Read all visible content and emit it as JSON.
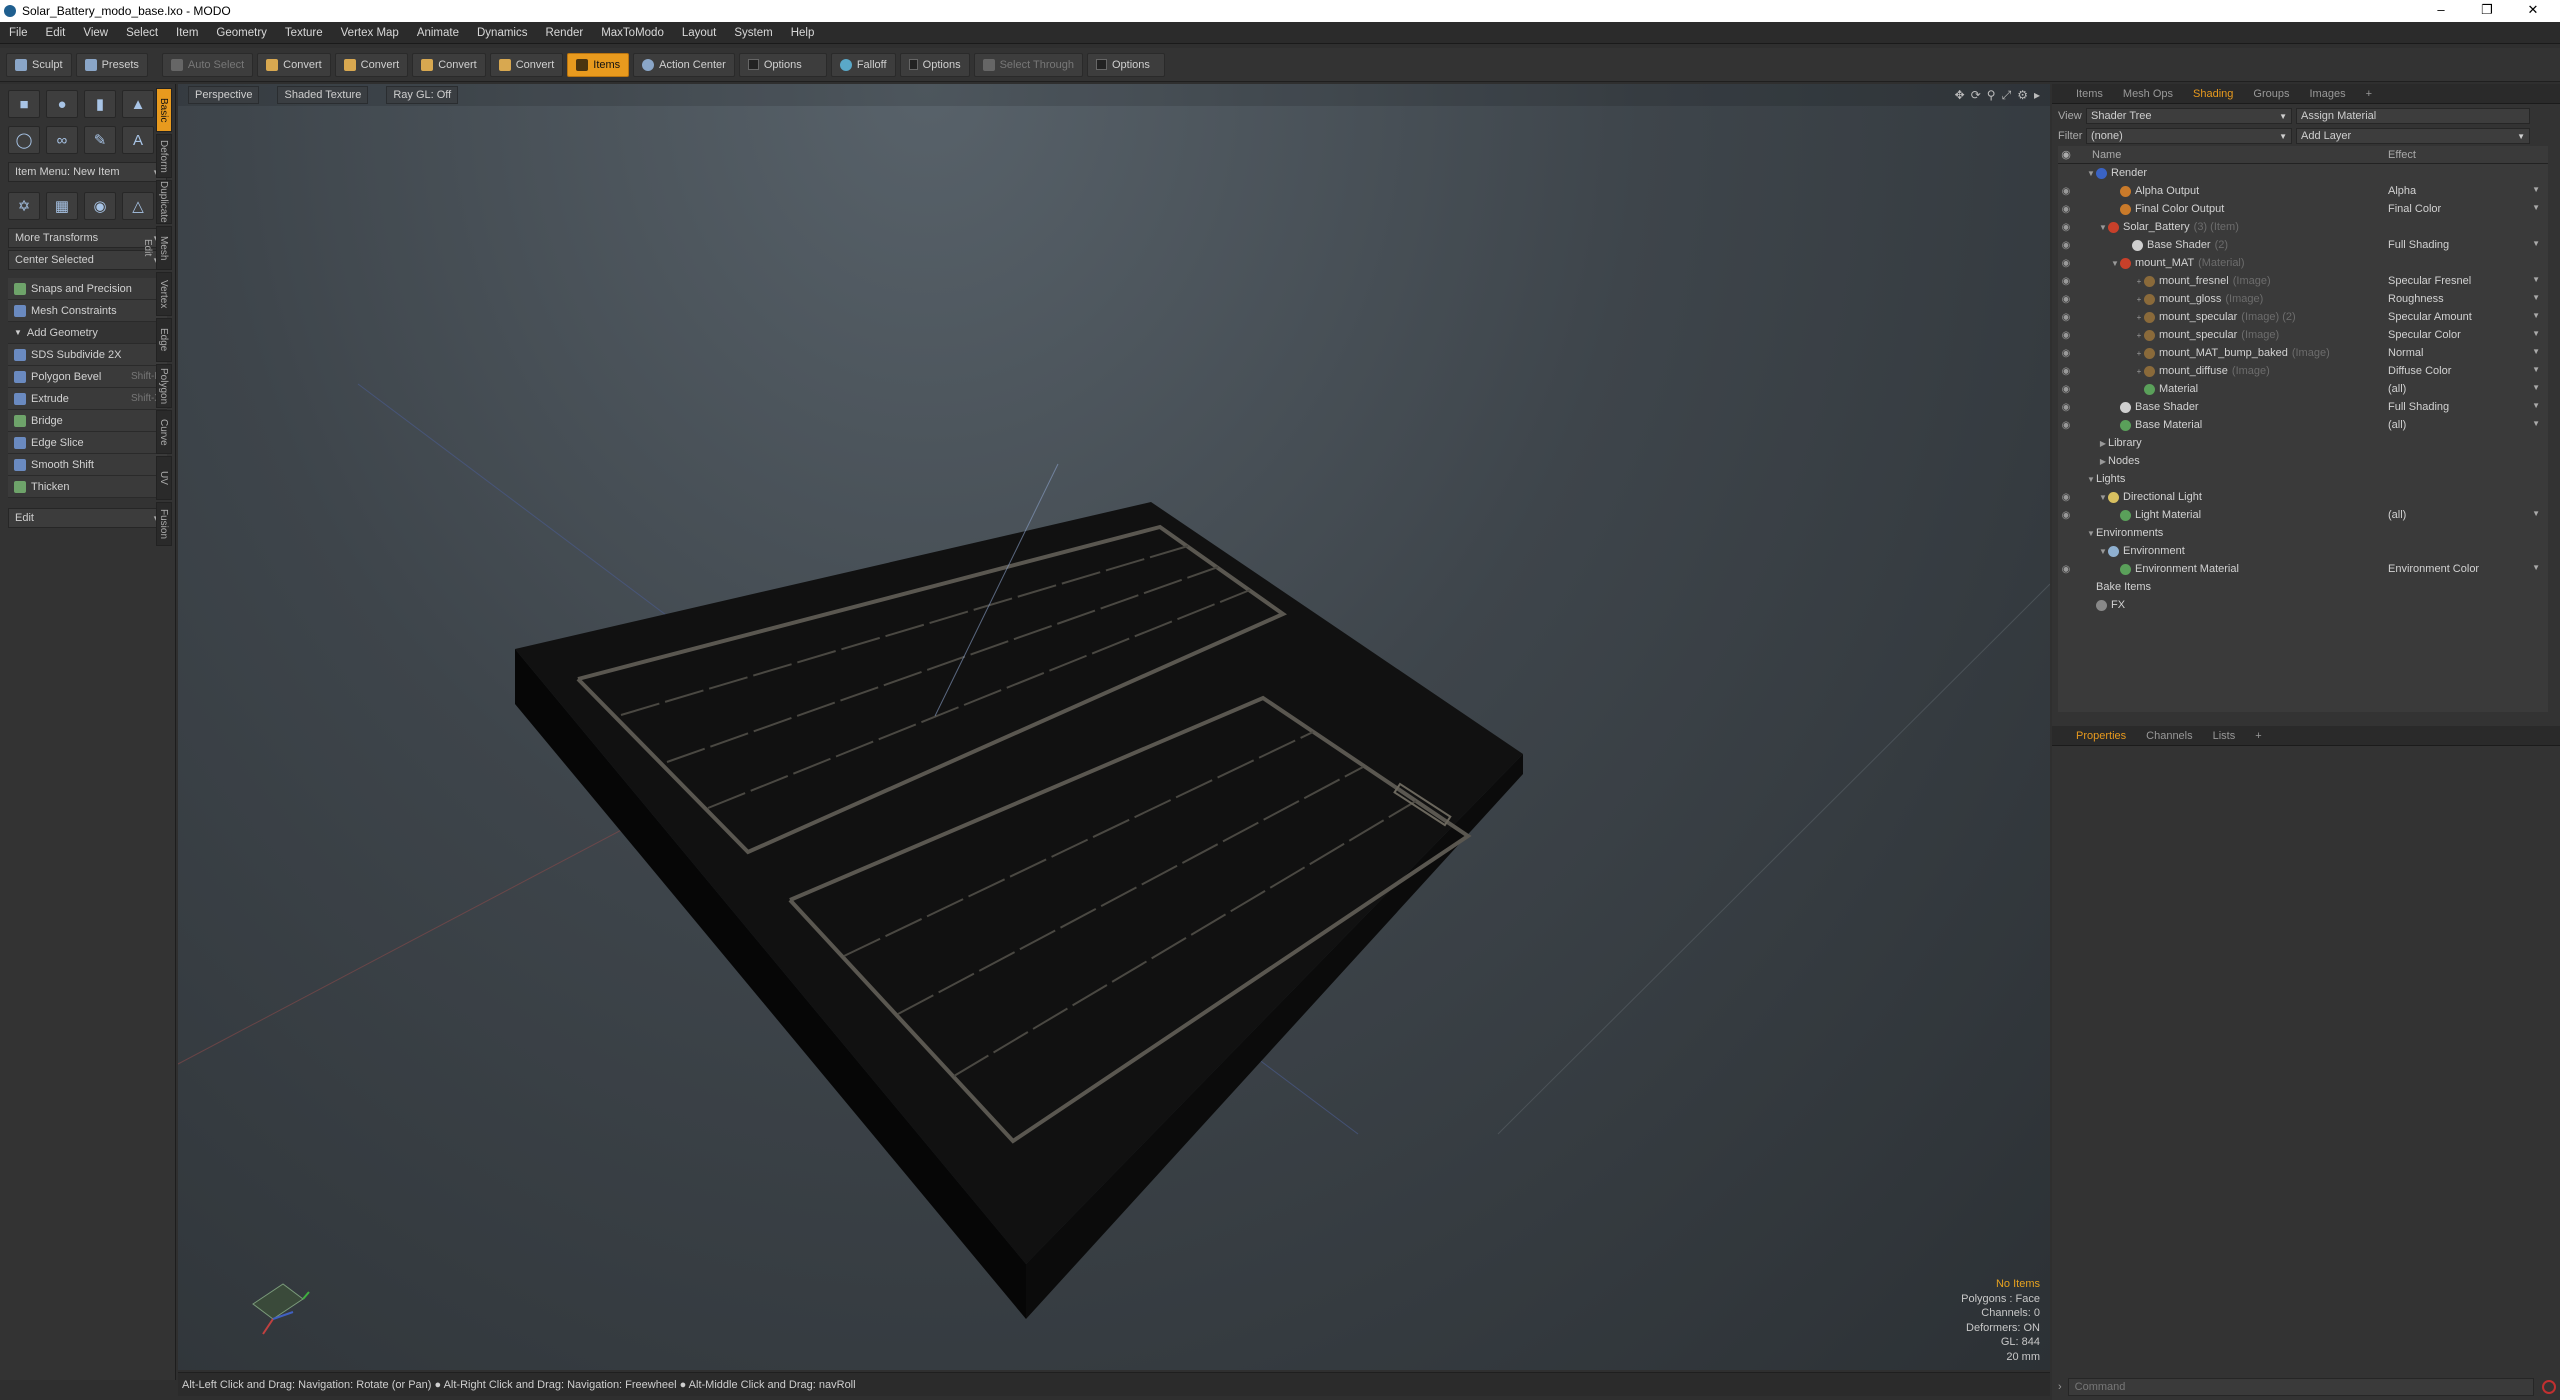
{
  "window": {
    "title": "Solar_Battery_modo_base.lxo - MODO"
  },
  "menu": [
    "File",
    "Edit",
    "View",
    "Select",
    "Item",
    "Geometry",
    "Texture",
    "Vertex Map",
    "Animate",
    "Dynamics",
    "Render",
    "MaxToModo",
    "Layout",
    "System",
    "Help"
  ],
  "toolbar": {
    "sculpt": "Sculpt",
    "presets": "Presets",
    "auto_select": "Auto Select",
    "convert1": "Convert",
    "convert2": "Convert",
    "convert3": "Convert",
    "convert4": "Convert",
    "items": "Items",
    "action_center": "Action Center",
    "options1": "Options",
    "falloff": "Falloff",
    "options2": "Options",
    "select_through": "Select Through",
    "options3": "Options"
  },
  "left": {
    "item_menu": "Item Menu: New Item",
    "more_transforms": "More Transforms",
    "center_selected": "Center Selected",
    "snaps": "Snaps and Precision",
    "mesh_constraints": "Mesh Constraints",
    "add_geometry": "Add Geometry",
    "sds": "SDS Subdivide 2X",
    "polygon_bevel": "Polygon Bevel",
    "polygon_bevel_sc": "Shift-B",
    "extrude": "Extrude",
    "extrude_sc": "Shift-X",
    "bridge": "Bridge",
    "edge_slice": "Edge Slice",
    "smooth_shift": "Smooth Shift",
    "thicken": "Thicken",
    "edit": "Edit",
    "vtabs": [
      "Basic",
      "Deform",
      "Duplicate",
      "Mesh Edit",
      "Vertex",
      "Edge",
      "Polygon",
      "Curve",
      "UV",
      "Fusion"
    ]
  },
  "viewport": {
    "perspective": "Perspective",
    "shaded_texture": "Shaded Texture",
    "ray_gl": "Ray GL: Off",
    "info": {
      "items": "No Items",
      "polygons": "Polygons : Face",
      "channels": "Channels: 0",
      "deformers": "Deformers: ON",
      "gl": "GL: 844",
      "mm": "20 mm"
    }
  },
  "status": "Alt-Left Click and Drag: Navigation: Rotate (or Pan) ●  Alt-Right Click and Drag: Navigation: Freewheel ●  Alt-Middle Click and Drag: navRoll",
  "right": {
    "tabs": [
      "Items",
      "Mesh Ops",
      "Shading",
      "Groups",
      "Images",
      "+"
    ],
    "view_label": "View",
    "view_value": "Shader Tree",
    "assign_material": "Assign Material",
    "filter_label": "Filter",
    "filter_value": "(none)",
    "add_layer": "Add Layer",
    "col_name": "Name",
    "col_effect": "Effect",
    "tree": [
      {
        "name": "Render",
        "tag": "",
        "effect": "",
        "indent": 0,
        "tw": "▼",
        "sw": "#3a63c4",
        "eye": false
      },
      {
        "name": "Alpha Output",
        "tag": "",
        "effect": "Alpha",
        "indent": 2,
        "tw": "",
        "sw": "#c97a2a",
        "eye": true
      },
      {
        "name": "Final Color Output",
        "tag": "",
        "effect": "Final Color",
        "indent": 2,
        "tw": "",
        "sw": "#c97a2a",
        "eye": true
      },
      {
        "name": "Solar_Battery",
        "tag": "(3) (Item)",
        "effect": "",
        "indent": 1,
        "tw": "▼",
        "sw": "#c8402a",
        "eye": true
      },
      {
        "name": "Base Shader",
        "tag": "(2)",
        "effect": "Full Shading",
        "indent": 3,
        "tw": "",
        "sw": "#cfcfcf",
        "eye": true
      },
      {
        "name": "mount_MAT",
        "tag": "(Material)",
        "effect": "",
        "indent": 2,
        "tw": "▼",
        "sw": "#c8402a",
        "eye": true
      },
      {
        "name": "mount_fresnel",
        "tag": "(Image)",
        "effect": "Specular Fresnel",
        "indent": 4,
        "tw": "+",
        "sw": "#8a6a3a",
        "eye": true
      },
      {
        "name": "mount_gloss",
        "tag": "(Image)",
        "effect": "Roughness",
        "indent": 4,
        "tw": "+",
        "sw": "#8a6a3a",
        "eye": true
      },
      {
        "name": "mount_specular",
        "tag": "(Image) (2)",
        "effect": "Specular Amount",
        "indent": 4,
        "tw": "+",
        "sw": "#8a6a3a",
        "eye": true
      },
      {
        "name": "mount_specular",
        "tag": "(Image)",
        "effect": "Specular Color",
        "indent": 4,
        "tw": "+",
        "sw": "#8a6a3a",
        "eye": true
      },
      {
        "name": "mount_MAT_bump_baked",
        "tag": "(Image)",
        "effect": "Normal",
        "indent": 4,
        "tw": "+",
        "sw": "#8a6a3a",
        "eye": true
      },
      {
        "name": "mount_diffuse",
        "tag": "(Image)",
        "effect": "Diffuse Color",
        "indent": 4,
        "tw": "+",
        "sw": "#8a6a3a",
        "eye": true
      },
      {
        "name": "Material",
        "tag": "",
        "effect": "(all)",
        "indent": 4,
        "tw": "",
        "sw": "#5aa05a",
        "eye": true
      },
      {
        "name": "Base Shader",
        "tag": "",
        "effect": "Full Shading",
        "indent": 2,
        "tw": "",
        "sw": "#cfcfcf",
        "eye": true
      },
      {
        "name": "Base Material",
        "tag": "",
        "effect": "(all)",
        "indent": 2,
        "tw": "",
        "sw": "#5aa05a",
        "eye": true
      },
      {
        "name": "Library",
        "tag": "",
        "effect": "",
        "indent": 1,
        "tw": "▶",
        "sw": "",
        "eye": false
      },
      {
        "name": "Nodes",
        "tag": "",
        "effect": "",
        "indent": 1,
        "tw": "▶",
        "sw": "",
        "eye": false
      },
      {
        "name": "Lights",
        "tag": "",
        "effect": "",
        "indent": 0,
        "tw": "▼",
        "sw": "",
        "eye": false
      },
      {
        "name": "Directional Light",
        "tag": "",
        "effect": "",
        "indent": 1,
        "tw": "▼",
        "sw": "#d8c060",
        "eye": true
      },
      {
        "name": "Light Material",
        "tag": "",
        "effect": "(all)",
        "indent": 2,
        "tw": "",
        "sw": "#5aa05a",
        "eye": true
      },
      {
        "name": "Environments",
        "tag": "",
        "effect": "",
        "indent": 0,
        "tw": "▼",
        "sw": "",
        "eye": false
      },
      {
        "name": "Environment",
        "tag": "",
        "effect": "",
        "indent": 1,
        "tw": "▼",
        "sw": "#8fb0d0",
        "eye": false
      },
      {
        "name": "Environment Material",
        "tag": "",
        "effect": "Environment Color",
        "indent": 2,
        "tw": "",
        "sw": "#5aa05a",
        "eye": true
      },
      {
        "name": "Bake Items",
        "tag": "",
        "effect": "",
        "indent": 0,
        "tw": "",
        "sw": "",
        "eye": false
      },
      {
        "name": "FX",
        "tag": "",
        "effect": "",
        "indent": 0,
        "tw": "",
        "sw": "#888",
        "eye": false
      }
    ],
    "prop_tabs": [
      "Properties",
      "Channels",
      "Lists",
      "+"
    ],
    "command_placeholder": "Command"
  }
}
